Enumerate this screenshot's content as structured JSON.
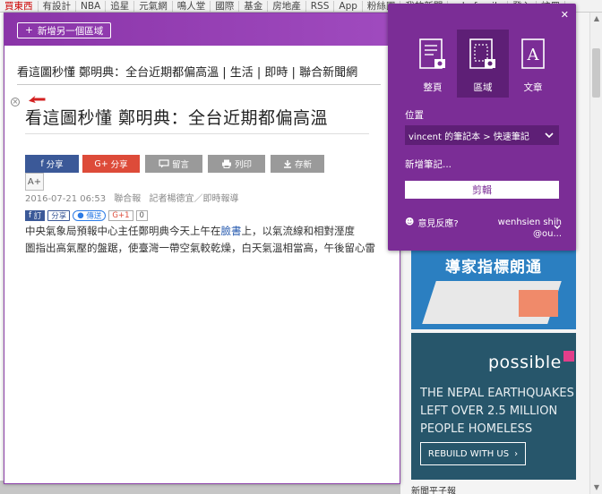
{
  "topnav": {
    "items": [
      "買東西",
      "有設計",
      "NBA",
      "追星",
      "元氣網",
      "鳴人堂",
      "國際",
      "基金",
      "房地產",
      "RSS",
      "App",
      "粉絲團",
      "我的新聞",
      "udn family",
      "登入",
      "註冊",
      "註冊"
    ]
  },
  "clipper": {
    "add_region_label": "新增另一個區域",
    "page_title": "看這圖秒懂 鄭明典：全台近期都偏高溫 | 生活 | 即時 | 聯合新聞網"
  },
  "article": {
    "title": "看這圖秒懂 鄭明典：全台近期都偏高溫",
    "share": {
      "fb": "分享",
      "gplus": "分享",
      "comment": "留言",
      "print": "列印",
      "save": "存新",
      "font_minus": "A-",
      "font_plus": "A+"
    },
    "date": "2016-07-21 06:53",
    "source": "聯合報",
    "author": "記者楊德宜／即時報導",
    "social": {
      "fb_label": "訂",
      "share_label": "分享",
      "line_label": "傳送",
      "gplus_label": "G+1",
      "gplus_count": "0"
    },
    "body_line1": "中央氣象局預報中心主任鄭明典今天上午在",
    "body_link": "臉書",
    "body_line1_rest": "上，以氣流線和相對溼度",
    "body_line2": "圖指出高氣壓的盤踞，使臺灣一帶空氣較乾燥，白天氣溫相當高，午後留心雷陣"
  },
  "panel": {
    "modes": [
      {
        "label": "整頁",
        "icon": "page-icon"
      },
      {
        "label": "區域",
        "icon": "region-icon"
      },
      {
        "label": "文章",
        "icon": "article-icon"
      }
    ],
    "location_label": "位置",
    "location_value": "vincent 的筆記本 > 快速筆記",
    "new_note": "新增筆記...",
    "clip_label": "剪輯",
    "feedback": "意見反應?",
    "user_line1": "wenhsien shih",
    "user_line2": "@ou...",
    "accent": "#7b2d96"
  },
  "ads": {
    "ad1_title": "導家指標朗通",
    "ad2_brand": "possible",
    "ad2_text": "THE NEPAL EARTHQUAKES LEFT OVER 2.5 MILLION PEOPLE HOMELESS",
    "ad2_btn": "REBUILD WITH US",
    "bottom_right": "新聞平子報"
  }
}
